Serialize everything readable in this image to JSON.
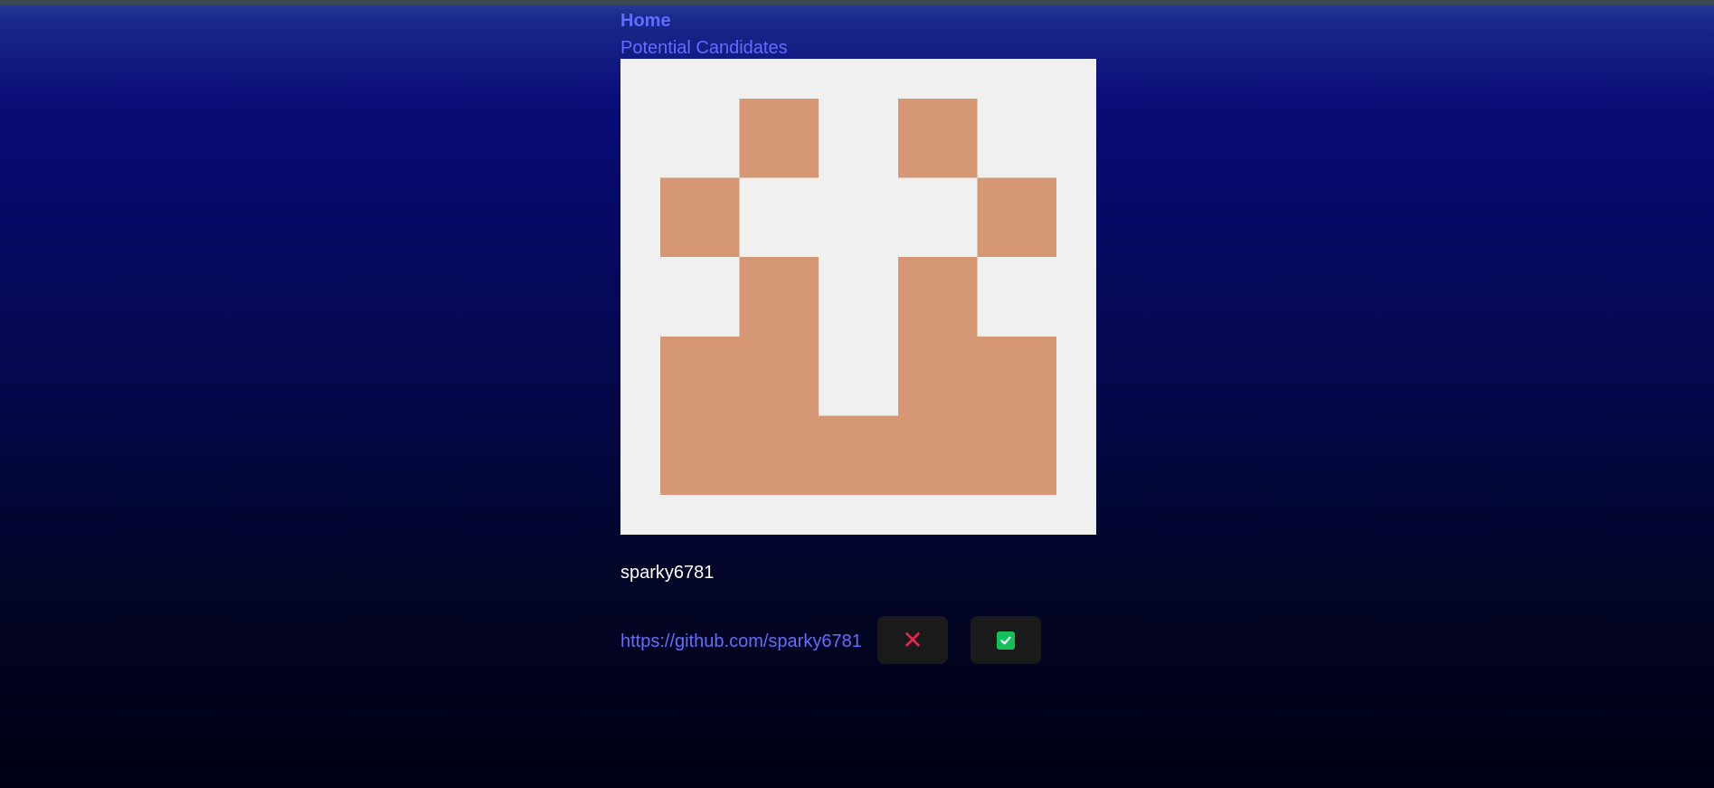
{
  "nav": {
    "home_label": "Home",
    "candidates_label": "Potential Candidates"
  },
  "candidate": {
    "username": "sparky6781",
    "github_url": "https://github.com/sparky6781",
    "avatar_background": "#f0f0f0",
    "avatar_color": "#d59774"
  },
  "actions": {
    "reject_icon": "x-mark-icon",
    "accept_icon": "check-box-icon",
    "reject_color": "#e8264c",
    "accept_color": "#13c15a"
  },
  "colors": {
    "link": "#646cff",
    "button_bg": "#1a1a1a"
  }
}
